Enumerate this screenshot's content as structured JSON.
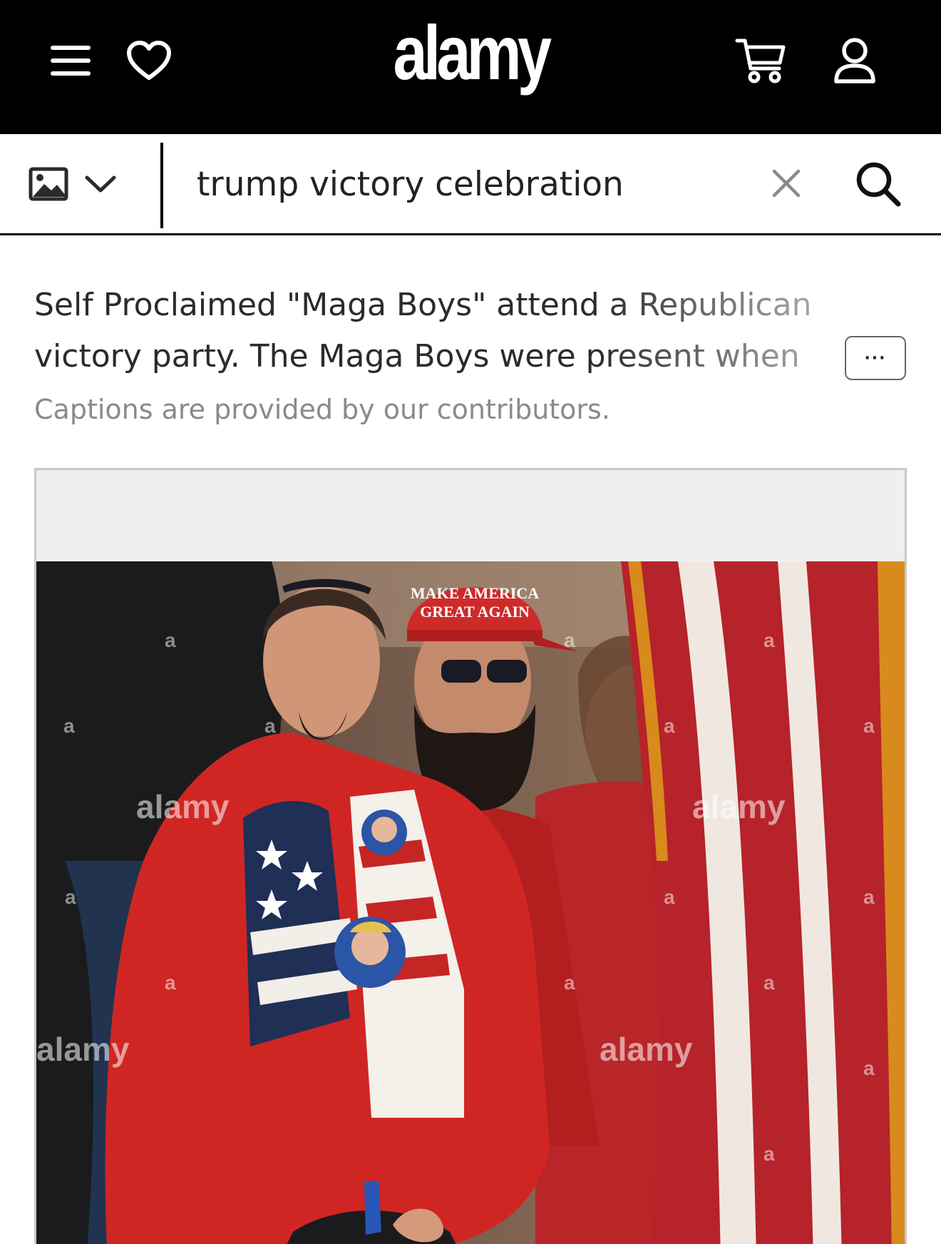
{
  "header": {
    "logo": "alamy",
    "icons": {
      "menu": "menu-icon",
      "favorites": "heart-icon",
      "cart": "cart-icon",
      "account": "user-icon"
    }
  },
  "search": {
    "media_type_icon": "image-icon",
    "query": "trump victory celebration",
    "clear_icon": "close-icon",
    "submit_icon": "search-icon"
  },
  "caption": {
    "text": "Self Proclaimed \"Maga Boys\" attend a Republican victory party. The Maga Boys were present when",
    "more_label": "···",
    "note": "Captions are provided by our contributors."
  },
  "photo": {
    "cap_text_line1": "MAKE AMERICA",
    "cap_text_line2": "GREAT AGAIN",
    "watermark": "alamy",
    "watermark_mark": "a"
  },
  "colors": {
    "topbar": "#000000",
    "accent": "#ffffff",
    "jacket_red": "#c8201e",
    "flag_gold": "#d98a1c"
  }
}
